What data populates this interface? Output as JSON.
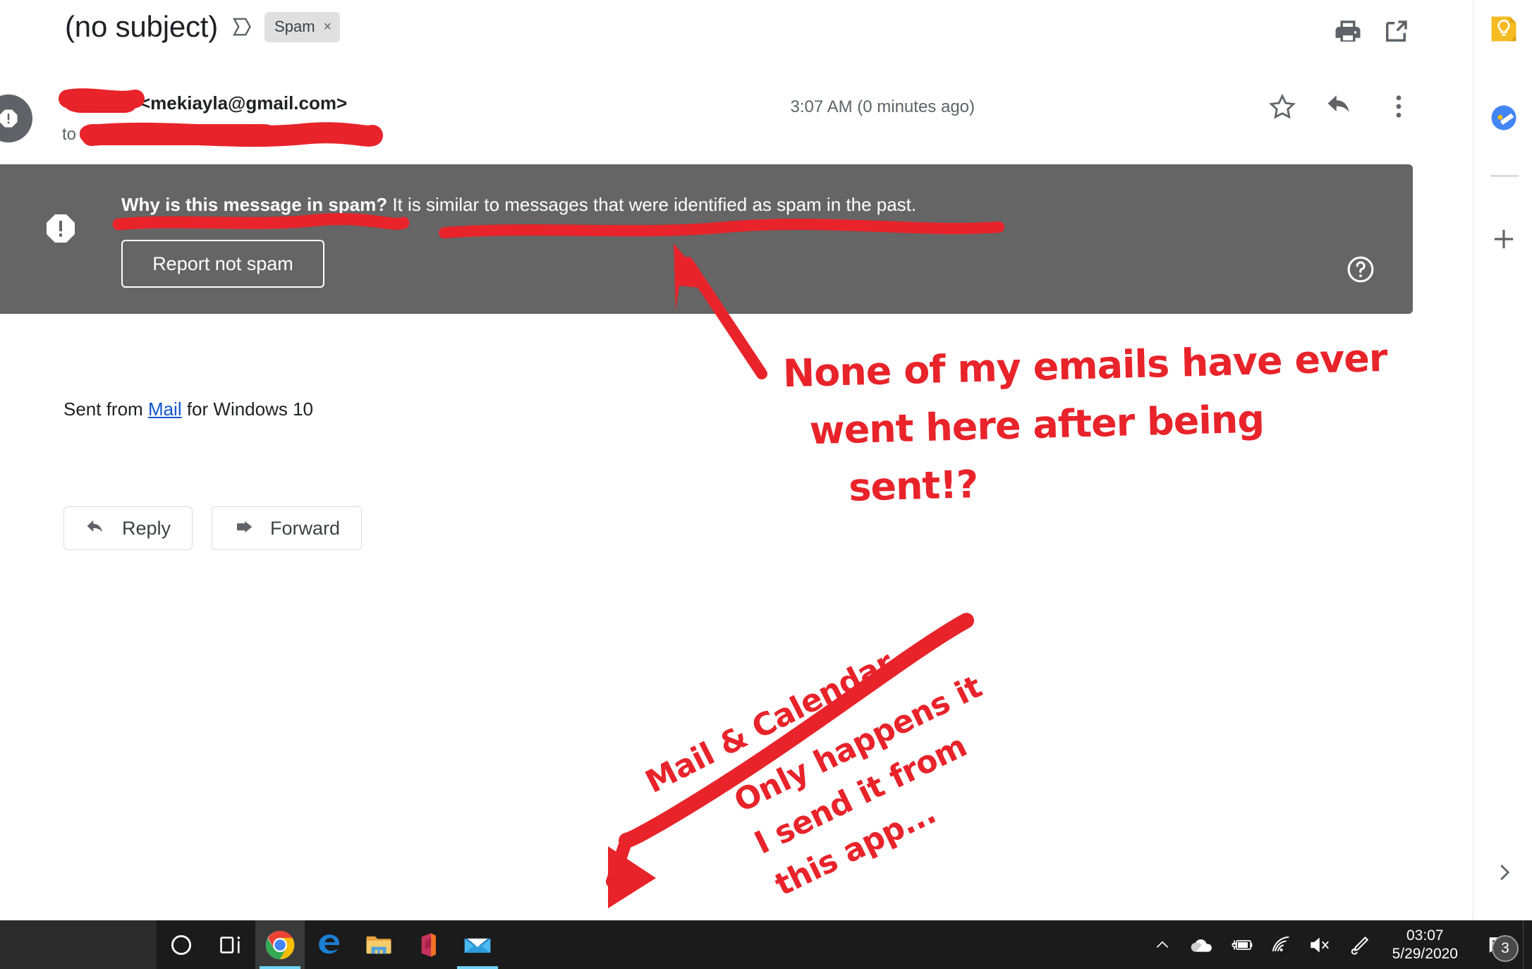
{
  "email": {
    "subject": "(no subject)",
    "labels": [
      {
        "name": "Spam",
        "close": "×"
      }
    ],
    "sender_address": "<mekiayla@gmail.com>",
    "to_label": "to",
    "timestamp": "3:07 AM (0 minutes ago)",
    "body_prefix": "Sent from ",
    "body_link": "Mail",
    "body_suffix": " for Windows 10",
    "actions": {
      "reply_label": "Reply",
      "forward_label": "Forward"
    },
    "icons": {
      "inbox_chevron": "inbox-chevron-icon",
      "print": "print-icon",
      "popout": "open-in-new-icon",
      "star": "star-icon",
      "reply": "reply-arrow-icon",
      "more": "more-vertical-icon",
      "warning_avatar": "warning-octagon-icon",
      "recipient_caret": "chevron-down-icon"
    }
  },
  "spam_banner": {
    "heading": "Why is this message in spam?",
    "explanation": " It is similar to messages that were identified as spam in the past.",
    "button_label": "Report not spam",
    "help_icon": "help-circle-icon",
    "warning_icon": "warning-octagon-icon",
    "background_color": "#656565"
  },
  "addon_sidebar": {
    "items": [
      {
        "name": "Keep",
        "icon": "keep-lightbulb-icon"
      },
      {
        "name": "Tasks",
        "icon": "tasks-check-icon"
      }
    ],
    "add_label": "+",
    "add_icon": "plus-icon",
    "expand_icon": "chevron-right-icon"
  },
  "taskbar": {
    "start_icon": "windows-start-icon",
    "apps": [
      {
        "name": "Cortana",
        "icon": "cortana-circle-icon",
        "active": false,
        "running": false
      },
      {
        "name": "Task View",
        "icon": "task-view-icon",
        "active": false,
        "running": false
      },
      {
        "name": "Google Chrome",
        "icon": "chrome-icon",
        "active": true,
        "running": true
      },
      {
        "name": "Microsoft Edge",
        "icon": "edge-icon",
        "active": false,
        "running": false
      },
      {
        "name": "File Explorer",
        "icon": "file-explorer-icon",
        "active": false,
        "running": false
      },
      {
        "name": "Office",
        "icon": "office-icon",
        "active": false,
        "running": false
      },
      {
        "name": "Mail",
        "icon": "mail-envelope-icon",
        "active": false,
        "running": true
      }
    ],
    "tray": [
      {
        "name": "show-hidden-icons",
        "icon": "chevron-up-icon"
      },
      {
        "name": "onedrive",
        "icon": "cloud-icon"
      },
      {
        "name": "battery-charging",
        "icon": "battery-charging-icon"
      },
      {
        "name": "wifi",
        "icon": "wifi-icon"
      },
      {
        "name": "volume-muted",
        "icon": "speaker-muted-icon"
      },
      {
        "name": "windows-ink-workspace",
        "icon": "pen-icon"
      }
    ],
    "clock_time": "03:07",
    "clock_date": "5/29/2020",
    "notification_count": "3",
    "notification_icon": "notification-message-icon"
  },
  "annotations": {
    "note_spam_banner": "None of my emails have ever\n  went here after being\n     sent!?",
    "note_app_name": "Mail & Calendar",
    "note_app_detail": "Only happens it\nI send it from\nthis app...",
    "ink_color": "#e8232a"
  }
}
